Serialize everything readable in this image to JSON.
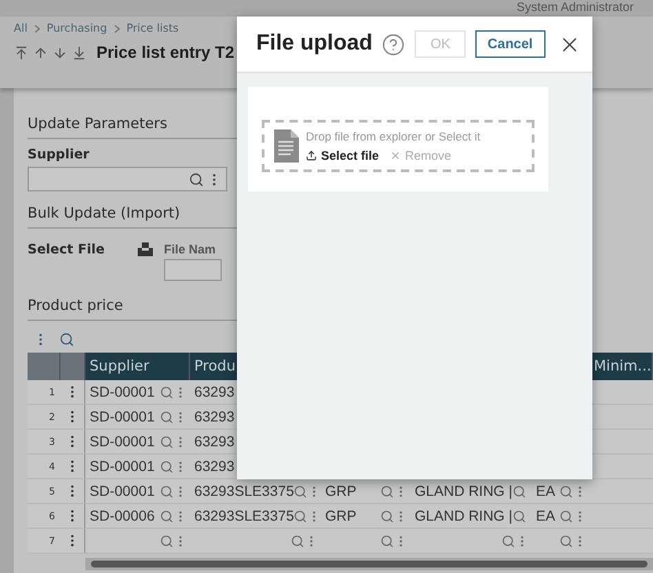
{
  "top_bar": {
    "user": "System Administrator"
  },
  "breadcrumb": [
    "All",
    "Purchasing",
    "Price lists"
  ],
  "title": "Price list entry T2",
  "update_parameters": {
    "heading": "Update Parameters",
    "supplier_label": "Supplier"
  },
  "bulk_update": {
    "heading": "Bulk Update (Import)",
    "select_file_label": "Select File",
    "file_name_label": "File Nam"
  },
  "product_price": {
    "heading": "Product price",
    "columns": [
      {
        "label": "Supplier"
      },
      {
        "label": "Produ"
      },
      null,
      null,
      null,
      {
        "label": "Minim..."
      }
    ],
    "rows": [
      {
        "number": "1",
        "cells": [
          {
            "text": "SD-00001",
            "lookup": true
          },
          {
            "text": "63293"
          }
        ]
      },
      {
        "number": "2",
        "cells": [
          {
            "text": "SD-00001",
            "lookup": true
          },
          {
            "text": "63293"
          }
        ]
      },
      {
        "number": "3",
        "cells": [
          {
            "text": "SD-00001",
            "lookup": true
          },
          {
            "text": "63293"
          }
        ]
      },
      {
        "number": "4",
        "cells": [
          {
            "text": "SD-00001",
            "lookup": true
          },
          {
            "text": "63293"
          }
        ]
      },
      {
        "number": "5",
        "cells": [
          {
            "text": "SD-00001",
            "lookup": true
          },
          {
            "text": "63293SLE3375",
            "lookup": true
          },
          {
            "text": "GRP",
            "lookup": true
          },
          {
            "text": "GLAND RING |",
            "lookup": true
          },
          {
            "text": "EA",
            "lookup": true
          }
        ]
      },
      {
        "number": "6",
        "cells": [
          {
            "text": "SD-00006",
            "lookup": true
          },
          {
            "text": "63293SLE3375",
            "lookup": true
          },
          {
            "text": "GRP",
            "lookup": true
          },
          {
            "text": "GLAND RING |",
            "lookup": true
          },
          {
            "text": "EA",
            "lookup": true
          }
        ]
      },
      {
        "number": "7",
        "cells": [
          {
            "lookup": true
          },
          {
            "lookup": true
          },
          {
            "lookup": true
          },
          {
            "lookup": true
          },
          {
            "lookup": true
          }
        ]
      }
    ]
  },
  "dialog": {
    "title": "File upload",
    "buttons": [
      {
        "label": "OK",
        "disabled": true
      },
      {
        "label": "Cancel",
        "disabled": false
      }
    ],
    "drop_hint": "Drop file from explorer or Select it",
    "select_file": "Select file",
    "remove": "Remove"
  }
}
